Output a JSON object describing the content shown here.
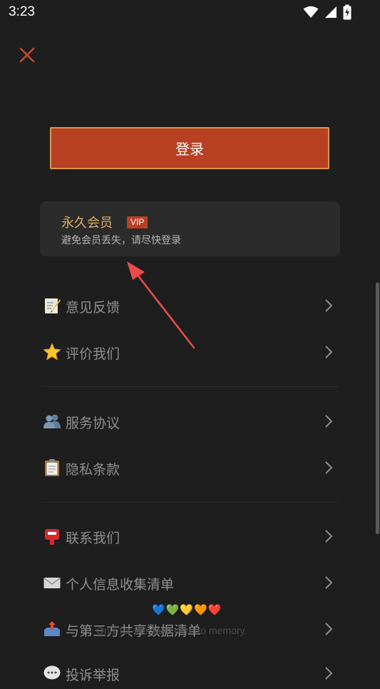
{
  "status_bar": {
    "time": "3:23"
  },
  "login": {
    "button_label": "登录"
  },
  "vip": {
    "title": "永久会员",
    "badge": "VIP",
    "subtitle": "避免会员丢失，请尽快登录"
  },
  "menu": {
    "items": [
      {
        "label": "意见反馈",
        "icon": "memo-icon"
      },
      {
        "label": "评价我们",
        "icon": "star-icon"
      },
      {
        "label": "服务协议",
        "icon": "people-icon"
      },
      {
        "label": "隐私条款",
        "icon": "clipboard-icon"
      },
      {
        "label": "联系我们",
        "icon": "postbox-icon"
      },
      {
        "label": "个人信息收集清单",
        "icon": "envelope-icon"
      },
      {
        "label": "与第三方共享数据清单",
        "icon": "outbox-tray-icon"
      },
      {
        "label": "投诉举报",
        "icon": "speech-bubble-icon"
      }
    ]
  },
  "footer": {
    "hearts": "💙💚💛🧡❤️",
    "watermark": "Only for the sake of retro memory."
  },
  "colors": {
    "accent": "#b84023",
    "accent_border": "#d9974a",
    "vip_gold": "#e3ad63",
    "annotation_arrow": "#e94b4b"
  }
}
